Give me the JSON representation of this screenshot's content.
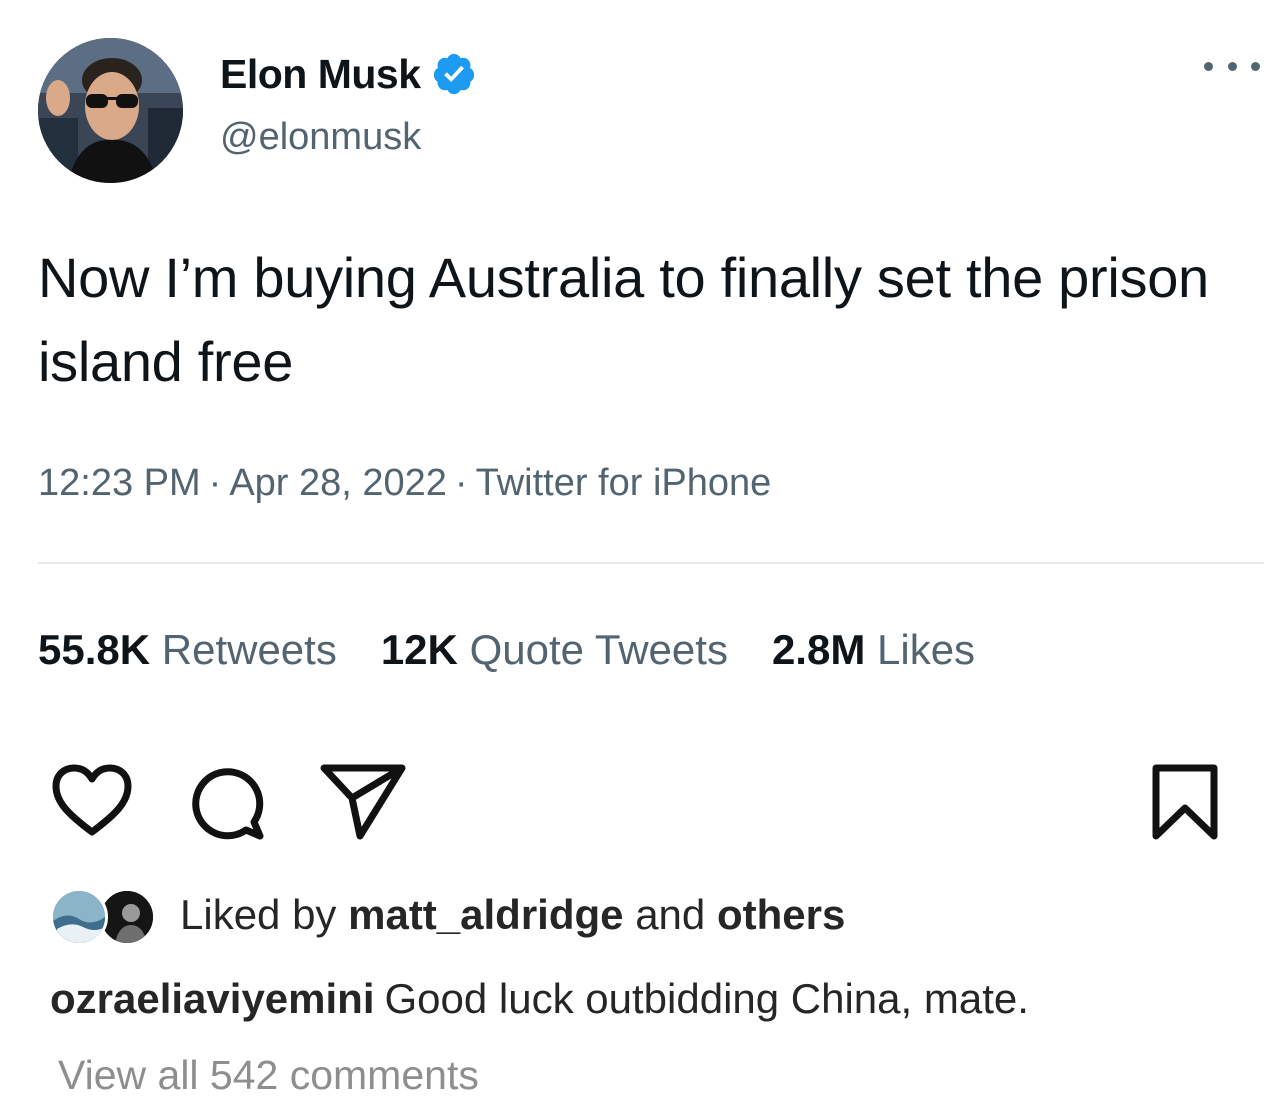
{
  "tweet": {
    "display_name": "Elon Musk",
    "handle": "@elonmusk",
    "verified": true,
    "text": "Now I’m buying Australia to finally set the prison island free",
    "time": "12:23 PM",
    "separator": "·",
    "date": "Apr 28, 2022",
    "source": "Twitter for iPhone",
    "stats": {
      "retweets_count": "55.8K",
      "retweets_label": "Retweets",
      "quotes_count": "12K",
      "quotes_label": "Quote Tweets",
      "likes_count": "2.8M",
      "likes_label": "Likes"
    },
    "more_icon": "more-horizontal-icon",
    "badge_color": "#1d9bf0"
  },
  "post": {
    "actions": {
      "like_icon": "heart-icon",
      "comment_icon": "comment-icon",
      "share_icon": "paper-plane-icon",
      "save_icon": "bookmark-icon"
    },
    "liked_by": {
      "prefix": "Liked by",
      "user": "matt_aldridge",
      "conjunction": "and",
      "others": "others"
    },
    "caption": {
      "username": "ozraeliaviyemini",
      "text": "Good luck outbidding China, mate."
    },
    "view_comments": "View all 542 comments"
  }
}
